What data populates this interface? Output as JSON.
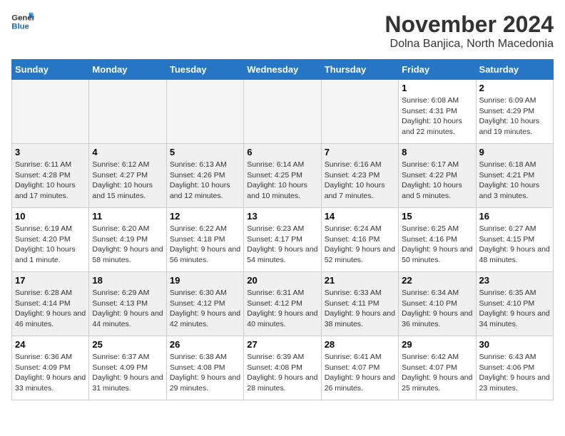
{
  "logo": {
    "text1": "General",
    "text2": "Blue"
  },
  "header": {
    "month": "November 2024",
    "location": "Dolna Banjica, North Macedonia"
  },
  "weekdays": [
    "Sunday",
    "Monday",
    "Tuesday",
    "Wednesday",
    "Thursday",
    "Friday",
    "Saturday"
  ],
  "weeks": [
    [
      {
        "day": "",
        "info": ""
      },
      {
        "day": "",
        "info": ""
      },
      {
        "day": "",
        "info": ""
      },
      {
        "day": "",
        "info": ""
      },
      {
        "day": "",
        "info": ""
      },
      {
        "day": "1",
        "info": "Sunrise: 6:08 AM\nSunset: 4:31 PM\nDaylight: 10 hours and 22 minutes."
      },
      {
        "day": "2",
        "info": "Sunrise: 6:09 AM\nSunset: 4:29 PM\nDaylight: 10 hours and 19 minutes."
      }
    ],
    [
      {
        "day": "3",
        "info": "Sunrise: 6:11 AM\nSunset: 4:28 PM\nDaylight: 10 hours and 17 minutes."
      },
      {
        "day": "4",
        "info": "Sunrise: 6:12 AM\nSunset: 4:27 PM\nDaylight: 10 hours and 15 minutes."
      },
      {
        "day": "5",
        "info": "Sunrise: 6:13 AM\nSunset: 4:26 PM\nDaylight: 10 hours and 12 minutes."
      },
      {
        "day": "6",
        "info": "Sunrise: 6:14 AM\nSunset: 4:25 PM\nDaylight: 10 hours and 10 minutes."
      },
      {
        "day": "7",
        "info": "Sunrise: 6:16 AM\nSunset: 4:23 PM\nDaylight: 10 hours and 7 minutes."
      },
      {
        "day": "8",
        "info": "Sunrise: 6:17 AM\nSunset: 4:22 PM\nDaylight: 10 hours and 5 minutes."
      },
      {
        "day": "9",
        "info": "Sunrise: 6:18 AM\nSunset: 4:21 PM\nDaylight: 10 hours and 3 minutes."
      }
    ],
    [
      {
        "day": "10",
        "info": "Sunrise: 6:19 AM\nSunset: 4:20 PM\nDaylight: 10 hours and 1 minute."
      },
      {
        "day": "11",
        "info": "Sunrise: 6:20 AM\nSunset: 4:19 PM\nDaylight: 9 hours and 58 minutes."
      },
      {
        "day": "12",
        "info": "Sunrise: 6:22 AM\nSunset: 4:18 PM\nDaylight: 9 hours and 56 minutes."
      },
      {
        "day": "13",
        "info": "Sunrise: 6:23 AM\nSunset: 4:17 PM\nDaylight: 9 hours and 54 minutes."
      },
      {
        "day": "14",
        "info": "Sunrise: 6:24 AM\nSunset: 4:16 PM\nDaylight: 9 hours and 52 minutes."
      },
      {
        "day": "15",
        "info": "Sunrise: 6:25 AM\nSunset: 4:16 PM\nDaylight: 9 hours and 50 minutes."
      },
      {
        "day": "16",
        "info": "Sunrise: 6:27 AM\nSunset: 4:15 PM\nDaylight: 9 hours and 48 minutes."
      }
    ],
    [
      {
        "day": "17",
        "info": "Sunrise: 6:28 AM\nSunset: 4:14 PM\nDaylight: 9 hours and 46 minutes."
      },
      {
        "day": "18",
        "info": "Sunrise: 6:29 AM\nSunset: 4:13 PM\nDaylight: 9 hours and 44 minutes."
      },
      {
        "day": "19",
        "info": "Sunrise: 6:30 AM\nSunset: 4:12 PM\nDaylight: 9 hours and 42 minutes."
      },
      {
        "day": "20",
        "info": "Sunrise: 6:31 AM\nSunset: 4:12 PM\nDaylight: 9 hours and 40 minutes."
      },
      {
        "day": "21",
        "info": "Sunrise: 6:33 AM\nSunset: 4:11 PM\nDaylight: 9 hours and 38 minutes."
      },
      {
        "day": "22",
        "info": "Sunrise: 6:34 AM\nSunset: 4:10 PM\nDaylight: 9 hours and 36 minutes."
      },
      {
        "day": "23",
        "info": "Sunrise: 6:35 AM\nSunset: 4:10 PM\nDaylight: 9 hours and 34 minutes."
      }
    ],
    [
      {
        "day": "24",
        "info": "Sunrise: 6:36 AM\nSunset: 4:09 PM\nDaylight: 9 hours and 33 minutes."
      },
      {
        "day": "25",
        "info": "Sunrise: 6:37 AM\nSunset: 4:09 PM\nDaylight: 9 hours and 31 minutes."
      },
      {
        "day": "26",
        "info": "Sunrise: 6:38 AM\nSunset: 4:08 PM\nDaylight: 9 hours and 29 minutes."
      },
      {
        "day": "27",
        "info": "Sunrise: 6:39 AM\nSunset: 4:08 PM\nDaylight: 9 hours and 28 minutes."
      },
      {
        "day": "28",
        "info": "Sunrise: 6:41 AM\nSunset: 4:07 PM\nDaylight: 9 hours and 26 minutes."
      },
      {
        "day": "29",
        "info": "Sunrise: 6:42 AM\nSunset: 4:07 PM\nDaylight: 9 hours and 25 minutes."
      },
      {
        "day": "30",
        "info": "Sunrise: 6:43 AM\nSunset: 4:06 PM\nDaylight: 9 hours and 23 minutes."
      }
    ]
  ]
}
